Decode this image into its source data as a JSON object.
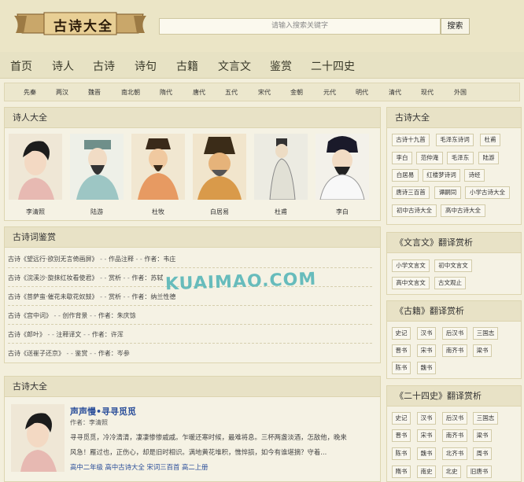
{
  "logo_text": "古诗大全",
  "search": {
    "placeholder": "请输入搜索关键字",
    "button": "搜索"
  },
  "nav": [
    "首页",
    "诗人",
    "古诗",
    "诗句",
    "古籍",
    "文言文",
    "鉴赏",
    "二十四史"
  ],
  "dynasties": [
    "先秦",
    "两汉",
    "魏晋",
    "南北朝",
    "隋代",
    "唐代",
    "五代",
    "宋代",
    "金朝",
    "元代",
    "明代",
    "清代",
    "现代",
    "外国"
  ],
  "poets_panel": {
    "title": "诗人大全",
    "poets": [
      "李清照",
      "陆游",
      "杜牧",
      "白居易",
      "杜甫",
      "李白"
    ]
  },
  "review_panel": {
    "title": "古诗词鉴赏",
    "items": [
      {
        "title": "古诗《望远行·欲别无言倚画屏》",
        "type": "作品注释",
        "author": "作者：韦庄"
      },
      {
        "title": "古诗《浣溪沙·旋抹红妆看使君》",
        "type": "赏析",
        "author": "作者：苏轼"
      },
      {
        "title": "古诗《菩萨蛮·催花未歇花奴鼓》",
        "type": "赏析",
        "author": "作者：纳兰性德"
      },
      {
        "title": "古诗《宫中词》",
        "type": "创作背景",
        "author": "作者：朱庆馀"
      },
      {
        "title": "古诗《郎叶》",
        "type": "注释译文",
        "author": "作者：许浑"
      },
      {
        "title": "古诗《送崔子还京》",
        "type": "鉴赏",
        "author": "作者：岑参"
      }
    ]
  },
  "poem_panel": {
    "title": "古诗大全",
    "poem_title": "声声慢•寻寻觅觅",
    "author": "作者：李清照",
    "excerpt_line1": "寻寻觅觅，冷冷清清，凄凄惨惨戚戚。乍暖还寒时候，最难将息。三杯两盏淡酒，怎敌他，晚来",
    "excerpt_line2": "风急！雁过也，正伤心，却是旧时相识。满地黄花堆积，憔悴损，如今有谁堪摘？守着...",
    "tags": "高中二年级 高中古诗大全 宋词三百首 高二上册"
  },
  "side_poems": {
    "title": "古诗大全",
    "tags": [
      "古诗十九首",
      "毛泽东诗词",
      "杜甫",
      "李白",
      "范仲淹",
      "毛泽东",
      "陆游",
      "白居易",
      "红楼梦诗词",
      "诗经",
      "唐诗三百首",
      "谭嗣同",
      "小学古诗大全",
      "初中古诗大全",
      "高中古诗大全"
    ]
  },
  "side_wyw": {
    "title": "《文言文》翻译赏析",
    "tags": [
      "小学文言文",
      "初中文言文",
      "高中文言文",
      "古文观止"
    ]
  },
  "side_guji": {
    "title": "《古籍》翻译赏析",
    "tags": [
      "史记",
      "汉书",
      "后汉书",
      "三国志",
      "晋书",
      "宋书",
      "南齐书",
      "梁书",
      "陈书",
      "魏书"
    ]
  },
  "side_24": {
    "title": "《二十四史》翻译赏析",
    "tags": [
      "史记",
      "汉书",
      "后汉书",
      "三国志",
      "晋书",
      "宋书",
      "南齐书",
      "梁书",
      "陈书",
      "魏书",
      "北齐书",
      "周书",
      "隋书",
      "南史",
      "北史",
      "旧唐书"
    ]
  },
  "watermark": "KUAIMAO.COM"
}
